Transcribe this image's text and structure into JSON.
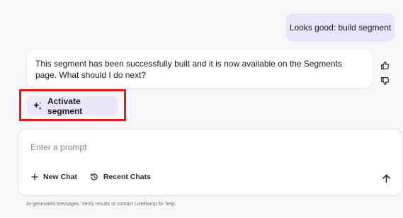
{
  "conversation": {
    "user_message": "Looks good: build segment",
    "assistant_message": "This segment has been successfully built and it is now available on the Segments page. What should I do next?",
    "feedback": {
      "thumbs_up_icon": "thumbs-up-icon",
      "thumbs_down_icon": "thumbs-down-icon"
    },
    "suggested_action": {
      "icon": "sparkle-icon",
      "label": "Activate segment"
    }
  },
  "prompt": {
    "placeholder": "Enter a prompt",
    "value": "",
    "new_chat_label": "New Chat",
    "recent_chats_label": "Recent Chats",
    "send_icon": "arrow-up-icon"
  },
  "footer": {
    "disclaimer": "AI-generated messages. Verify results or contact LiveRamp for help."
  },
  "colors": {
    "background": "#f7f6f8",
    "user_bubble": "#e9e4f7",
    "action_chip": "#ece6fb",
    "highlight_border": "#e21a1a"
  }
}
